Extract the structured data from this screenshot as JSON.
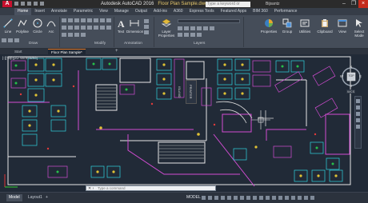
{
  "window": {
    "app_title": "Autodesk AutoCAD 2016",
    "file_name": "Floor Plan Sample.dwg",
    "search_placeholder": "Type a keyword or phrase",
    "user": "Bijsantz",
    "logo_letter": "A"
  },
  "ribbon_tabs": [
    "Home",
    "Insert",
    "Annotate",
    "Parametric",
    "View",
    "Manage",
    "Output",
    "Add-ins",
    "A360",
    "Express Tools",
    "Featured Apps",
    "BIM 360",
    "Performance"
  ],
  "active_tab": "Home",
  "ribbon": {
    "draw_tools": [
      "Line",
      "Polyline",
      "Circle",
      "Arc"
    ],
    "annotation_tools": [
      "Text",
      "Dimension"
    ],
    "layer_tools": [
      "Layer Properties"
    ],
    "right_tools": [
      "Properties",
      "Group",
      "Utilities",
      "Clipboard",
      "View",
      "Select Mode"
    ],
    "panels": [
      "Draw",
      "Modify",
      "Annotation",
      "Layers"
    ]
  },
  "file_tabs": [
    "Start",
    "Floor Plan Sample*"
  ],
  "viewport_label": "[-][Top][2D Wireframe]",
  "viewcube": {
    "top": "N",
    "bottom": "S",
    "left": "W",
    "right": "E",
    "center": "TOP",
    "ucs": "WCS"
  },
  "command_line": {
    "placeholder": "Type a command"
  },
  "layout_tabs": [
    "Model",
    "Layout1"
  ],
  "active_layout": "Model",
  "status": {
    "model": "MODEL"
  },
  "drawing_labels": [
    "PRINTER",
    "ISLAND"
  ]
}
